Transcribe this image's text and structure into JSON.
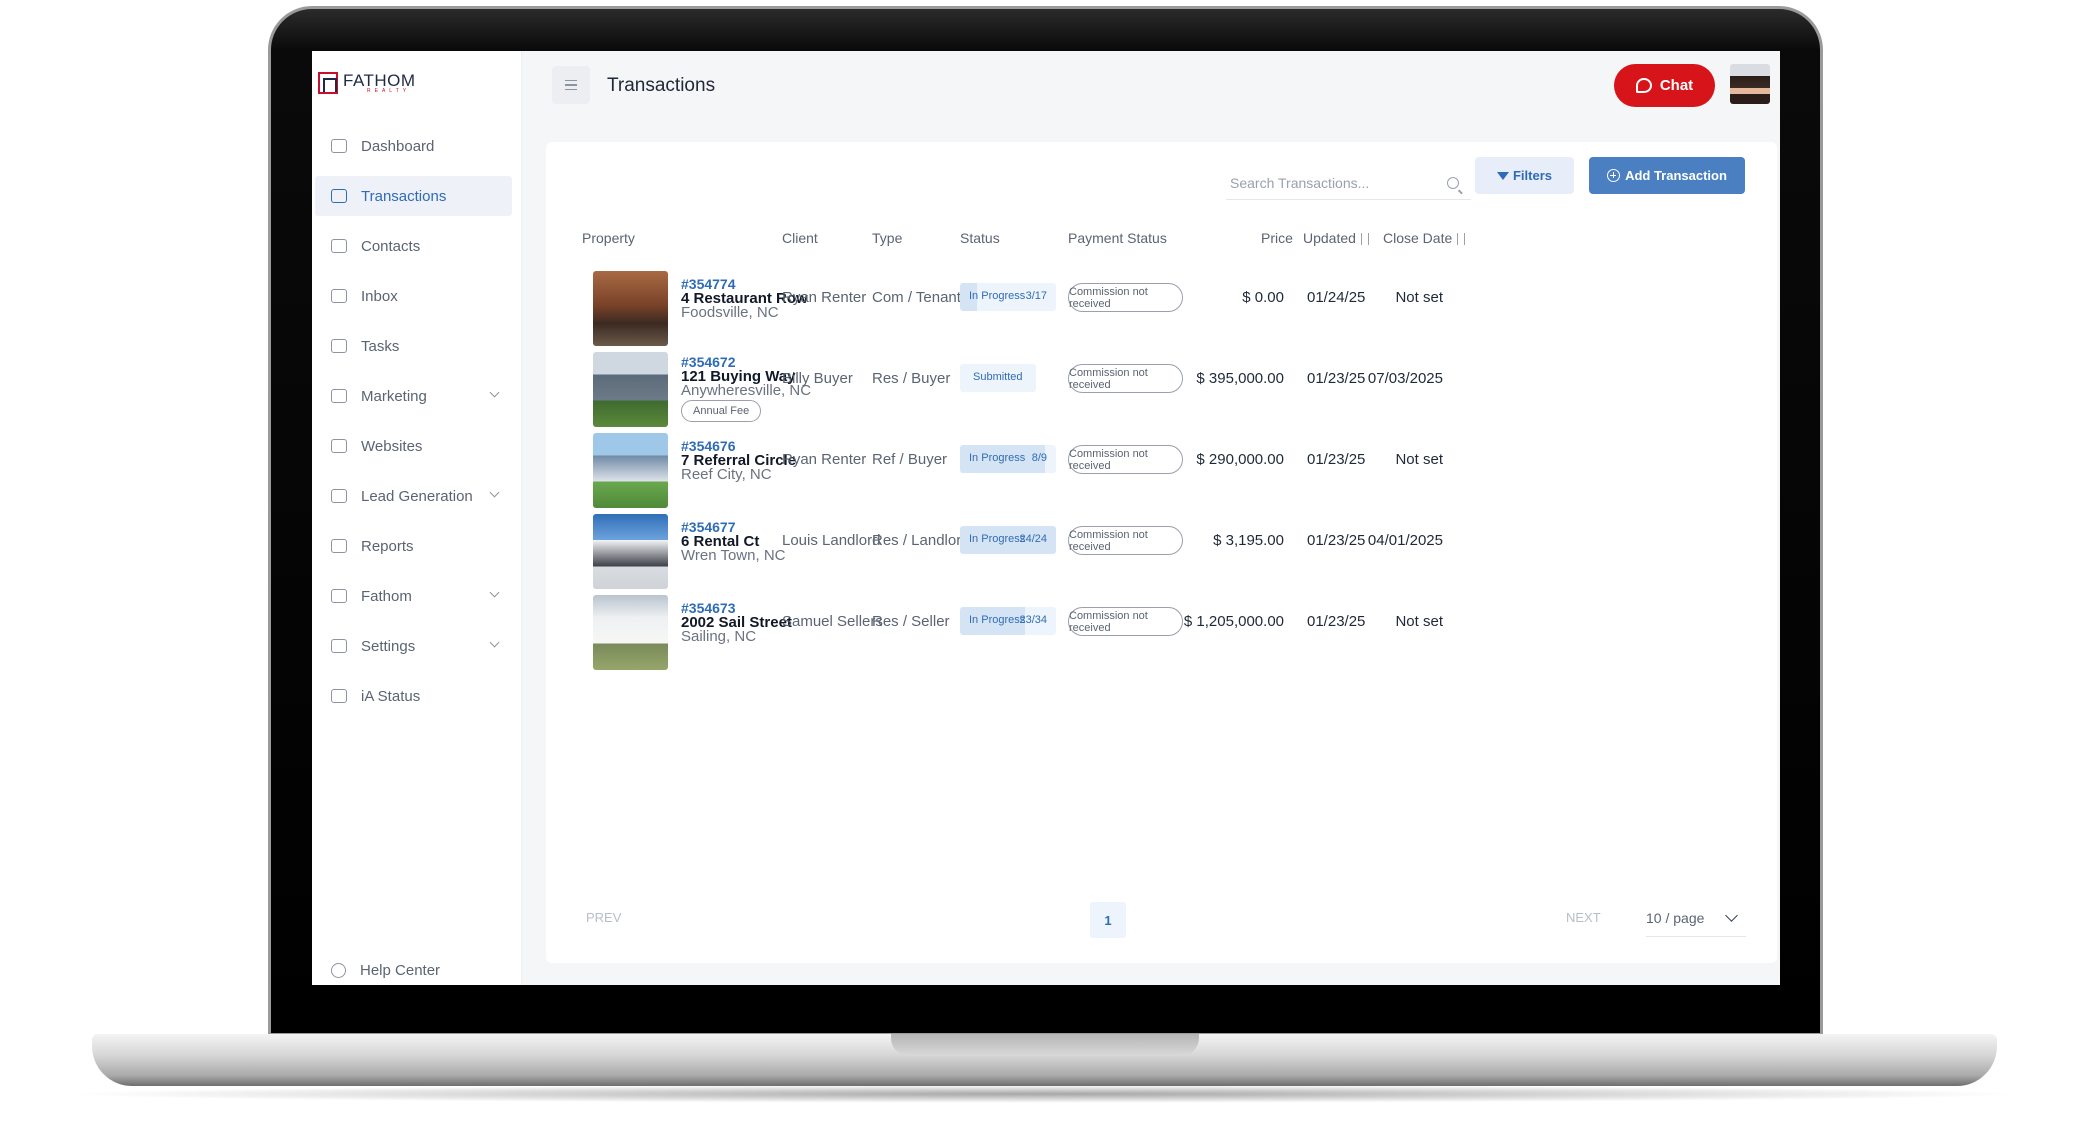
{
  "brand": {
    "name": "FATHOM",
    "sub": "REALTY",
    "red": "#c8102e",
    "navy": "#1f2a44",
    "accent": "#2f6cb5"
  },
  "sidebar": {
    "items": [
      {
        "label": "Dashboard",
        "icon": "dashboard-icon",
        "active": false,
        "expandable": false
      },
      {
        "label": "Transactions",
        "icon": "briefcase-icon",
        "active": true,
        "expandable": false
      },
      {
        "label": "Contacts",
        "icon": "contacts-icon",
        "active": false,
        "expandable": false
      },
      {
        "label": "Inbox",
        "icon": "inbox-icon",
        "active": false,
        "expandable": false
      },
      {
        "label": "Tasks",
        "icon": "tasks-icon",
        "active": false,
        "expandable": false
      },
      {
        "label": "Marketing",
        "icon": "megaphone-icon",
        "active": false,
        "expandable": true
      },
      {
        "label": "Websites",
        "icon": "laptop-icon",
        "active": false,
        "expandable": false
      },
      {
        "label": "Lead Generation",
        "icon": "funnel-icon",
        "active": false,
        "expandable": true
      },
      {
        "label": "Reports",
        "icon": "chart-icon",
        "active": false,
        "expandable": false
      },
      {
        "label": "Fathom",
        "icon": "fathom-icon",
        "active": false,
        "expandable": true
      },
      {
        "label": "Settings",
        "icon": "gear-icon",
        "active": false,
        "expandable": true
      },
      {
        "label": "iA Status",
        "icon": "info-icon",
        "active": false,
        "expandable": false
      }
    ],
    "help": "Help Center"
  },
  "header": {
    "title": "Transactions",
    "chat_label": "Chat"
  },
  "toolbar": {
    "search_placeholder": "Search Transactions...",
    "filters_label": "Filters",
    "add_label": "Add Transaction"
  },
  "table": {
    "columns": {
      "property": "Property",
      "client": "Client",
      "type": "Type",
      "status": "Status",
      "payment": "Payment Status",
      "price": "Price",
      "updated": "Updated",
      "close": "Close Date"
    },
    "rows": [
      {
        "id": "#354774",
        "address": "4 Restaurant Row",
        "city": "Foodsville, NC",
        "badge": "",
        "client": "Ryan Renter",
        "type": "Com / Tenant",
        "status": "In Progress",
        "count": "3/17",
        "progress": 0.18,
        "payment": "Commission not received",
        "price": "$ 0.00",
        "updated": "01/24/25",
        "close": "Not set"
      },
      {
        "id": "#354672",
        "address": "121 Buying Way",
        "city": "Anywheresville, NC",
        "badge": "Annual Fee",
        "client": "Billy Buyer",
        "type": "Res / Buyer",
        "status": "Submitted",
        "count": "",
        "progress": 0,
        "payment": "Commission not received",
        "price": "$ 395,000.00",
        "updated": "01/23/25",
        "close": "07/03/2025"
      },
      {
        "id": "#354676",
        "address": "7 Referral Circle",
        "city": "Reef City, NC",
        "badge": "",
        "client": "Ryan Renter",
        "type": "Ref / Buyer",
        "status": "In Progress",
        "count": "8/9",
        "progress": 0.89,
        "payment": "Commission not received",
        "price": "$ 290,000.00",
        "updated": "01/23/25",
        "close": "Not set"
      },
      {
        "id": "#354677",
        "address": "6 Rental Ct",
        "city": "Wren Town, NC",
        "badge": "",
        "client": "Louis Landlord",
        "type": "Res / Landlord",
        "status": "In Progress",
        "count": "24/24",
        "progress": 1.0,
        "payment": "Commission not received",
        "price": "$ 3,195.00",
        "updated": "01/23/25",
        "close": "04/01/2025"
      },
      {
        "id": "#354673",
        "address": "2002 Sail Street",
        "city": "Sailing, NC",
        "badge": "",
        "client": "Samuel Sellers",
        "type": "Res / Seller",
        "status": "In Progress",
        "count": "23/34",
        "progress": 0.68,
        "payment": "Commission not received",
        "price": "$ 1,205,000.00",
        "updated": "01/23/25",
        "close": "Not set"
      }
    ]
  },
  "pager": {
    "prev": "PREV",
    "page": "1",
    "next": "NEXT",
    "per_page": "10 / page"
  }
}
